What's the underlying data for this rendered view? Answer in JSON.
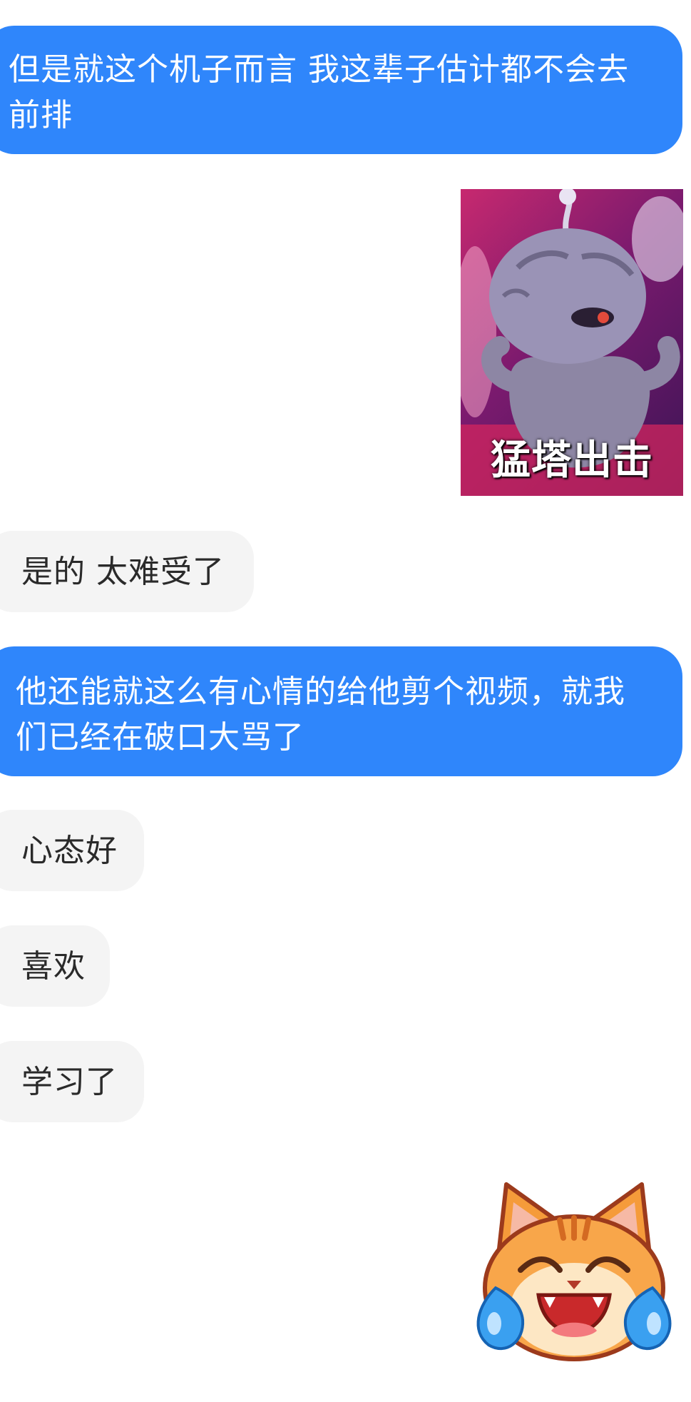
{
  "chat": {
    "messages": [
      {
        "side": "sent",
        "text": "但是就这个机子而言 我这辈子估计都不会去前排"
      },
      {
        "side": "received-sticker",
        "caption": "猛塔出击"
      },
      {
        "side": "received",
        "text": "是的 太难受了"
      },
      {
        "side": "sent",
        "text": "他还能就这么有心情的给他剪个视频，就我们已经在破口大骂了"
      },
      {
        "side": "received",
        "text": "心态好"
      },
      {
        "side": "received",
        "text": "喜欢"
      },
      {
        "side": "received",
        "text": "学习了"
      },
      {
        "side": "received-emoji",
        "icon": "laughing-crying-cat-icon"
      }
    ]
  },
  "colors": {
    "sent_bubble": "#2f86fb",
    "received_bubble": "#f4f4f4",
    "background": "#ffffff"
  }
}
